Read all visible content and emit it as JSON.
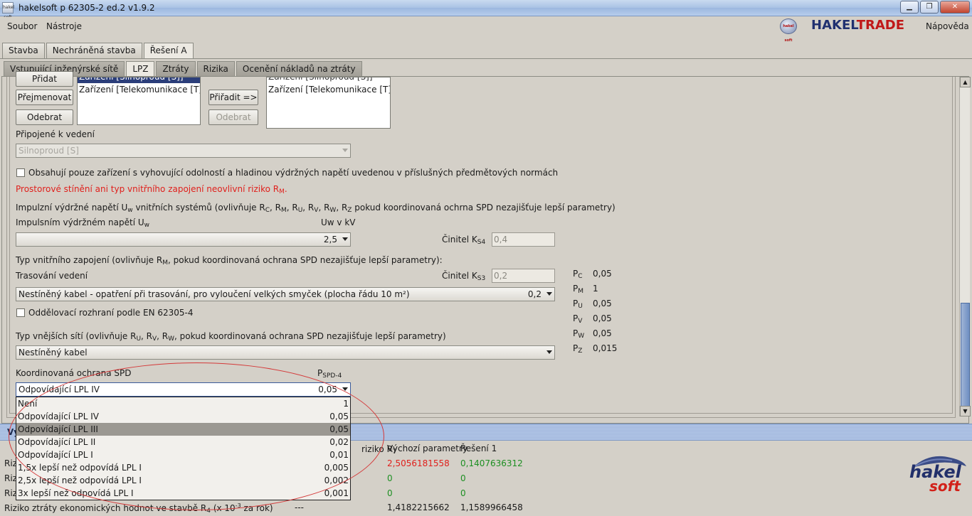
{
  "window": {
    "title": "hakelsoft p 62305-2 ed.2 v1.9.2",
    "icon_text": "hakel soft"
  },
  "menu": {
    "file": "Soubor",
    "tools": "Nástroje",
    "help": "Nápověda"
  },
  "brand": {
    "part1": "HAKEL",
    "part2": "TRADE",
    "small_logo": "hakel soft"
  },
  "tabs_main": [
    "Stavba",
    "Nechráněná stavba",
    "Řešení A"
  ],
  "tabs_sub": [
    "Vstupující inženýrské sítě",
    "LPZ",
    "Ztráty",
    "Rizika",
    "Ocenění nákladů na ztráty"
  ],
  "buttons": {
    "add": "Přidat",
    "rename": "Přejmenovat",
    "remove": "Odebrat",
    "assign": "Přiřadit =>",
    "unassign": "Odebrat"
  },
  "left_list": [
    "Zařízení [Silnoproud [S]]",
    "Zařízení [Telekomunikace [T]]"
  ],
  "right_list": [
    "Zařízení [Silnoproud [S]]",
    "Zařízení [Telekomunikace [T]]"
  ],
  "connected": {
    "label": "Připojené k vedení",
    "value": "Silnoproud [S]"
  },
  "checkbox1": "Obsahují pouze zařízení s vyhovující odolností a hladinou výdržných napětí uvedenou v příslušných předmětových normách",
  "warning": {
    "text": "Prostorové stínění ani typ vnitřního zapojení neovlivní riziko R",
    "sub": "M",
    "end": "."
  },
  "impulse": {
    "heading": "Impulzní výdržné napětí U",
    "label": "Impulsním výdržném napětí U",
    "unit_label": "Uw v kV",
    "value": "2,5",
    "ks4_label": "Činitel K",
    "ks4_value": "0,4"
  },
  "internal": {
    "heading": "Typ vnitřního zapojení (ovlivňuje R",
    "routing_label": "Trasování vedení",
    "ks3_label": "Činitel K",
    "ks3_value": "0,2",
    "routing_value": "Nestíněný kabel - opatření při trasování, pro vyloučení velkých smyček (plocha řádu 10 m²)",
    "routing_factor": "0,2"
  },
  "checkbox2": "Oddělovací rozhraní podle EN 62305-4",
  "external": {
    "heading": "Typ vnějších sítí (ovlivňuje R",
    "value": "Nestíněný kabel"
  },
  "spd": {
    "label": "Koordinovaná ochrana SPD",
    "p_label": "P",
    "p_sub": "SPD-4",
    "selected": "Odpovídající LPL IV",
    "selected_value": "0,05",
    "options": [
      {
        "label": "Není",
        "value": "1"
      },
      {
        "label": "Odpovídající LPL IV",
        "value": "0,05"
      },
      {
        "label": "Odpovídající LPL III",
        "value": "0,05"
      },
      {
        "label": "Odpovídající LPL II",
        "value": "0,02"
      },
      {
        "label": "Odpovídající LPL I",
        "value": "0,01"
      },
      {
        "label": "1,5x lepší než odpovídá LPL I",
        "value": "0,005"
      },
      {
        "label": "2,5x lepší než odpovídá LPL I",
        "value": "0,002"
      },
      {
        "label": "3x lepší než odpovídá LPL I",
        "value": "0,001"
      }
    ]
  },
  "probabilities": [
    {
      "name": "P",
      "sub": "C",
      "value": "0,05"
    },
    {
      "name": "P",
      "sub": "M",
      "value": "1"
    },
    {
      "name": "P",
      "sub": "U",
      "value": "0,05"
    },
    {
      "name": "P",
      "sub": "V",
      "value": "0,05"
    },
    {
      "name": "P",
      "sub": "W",
      "value": "0,05"
    },
    {
      "name": "P",
      "sub": "Z",
      "value": "0,015"
    }
  ],
  "bottom": {
    "bar_label": "Vy",
    "col_tolerable": "riziko R",
    "col_tolerable_sub": "T",
    "col_default": "Výchozí parametry",
    "col_solution": "Řešení 1",
    "rows": [
      {
        "label": "Rizi",
        "default": "2,5056181558",
        "solution": "0,1407636312"
      },
      {
        "label": "Riz",
        "default": "0",
        "solution": "0"
      },
      {
        "label": "Riz",
        "default": "0",
        "solution": "0"
      }
    ],
    "last_label": "Riziko ztráty ekonomických hodnot ve stavbě R",
    "last_sub": "4",
    "last_unit_pre": "(x 10",
    "last_unit_sup": "-3",
    "last_unit_post": " za rok)",
    "last_tolerable": "---",
    "last_default": "1,4182215662",
    "last_solution": "1,1589966458"
  },
  "logo": {
    "line1": "hakel",
    "line2": "soft"
  },
  "colors": {
    "danger": "#e0201c",
    "ok": "#1d8f22",
    "selection": "#2b3e7a",
    "circle": "#d43a3a"
  }
}
